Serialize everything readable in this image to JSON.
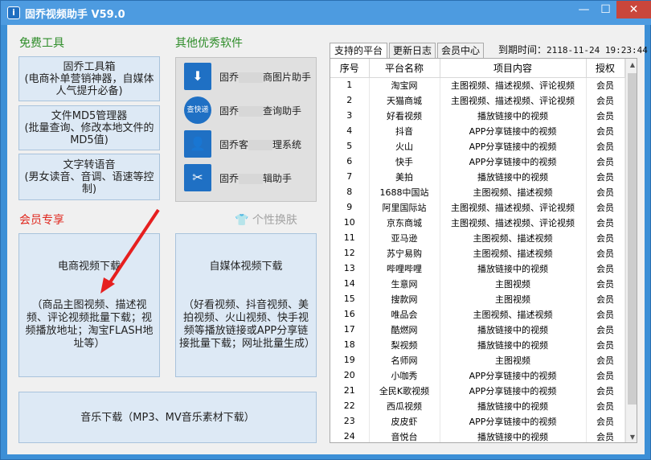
{
  "window": {
    "title": "固乔视频助手 V59.0",
    "icon_letter": "i",
    "minimize": "—",
    "maximize": "☐",
    "close": "✕"
  },
  "free_tools": {
    "heading": "免费工具",
    "buttons": [
      {
        "label": "固乔工具箱\n(电商补单营销神器，自媒体人气提升必备)"
      },
      {
        "label": "文件MD5管理器\n(批量查询、修改本地文件的MD5值)"
      },
      {
        "label": "文字转语音\n(男女读音、音调、语速等控制)"
      }
    ]
  },
  "other_software": {
    "heading": "其他优秀软件",
    "items": [
      {
        "icon": "download-icon",
        "prefix": "固乔",
        "suffix": "商图片助手"
      },
      {
        "icon": "quick-search-icon",
        "prefix": "固乔",
        "suffix": "查询助手"
      },
      {
        "icon": "person-icon",
        "prefix": "固乔客",
        "suffix": "理系统"
      },
      {
        "icon": "scissors-icon",
        "prefix": "固乔",
        "suffix": "辑助手"
      }
    ],
    "skin_label": "个性换肤"
  },
  "member": {
    "heading": "会员专享",
    "ecom_button": "电商视频下载\n\n\n（商品主图视频、描述视频、评论视频批量下载；视频播放地址；淘宝FLASH地址等）",
    "media_button": "自媒体视频下载\n\n\n（好看视频、抖音视频、美拍视频、火山视频、快手视频等播放链接或APP分享链接批量下载；网址批量生成）",
    "music_button": "音乐下载（MP3、MV音乐素材下载）"
  },
  "tabs": [
    "支持的平台",
    "更新日志",
    "会员中心"
  ],
  "expire": {
    "label": "到期时间：",
    "value": "2118-11-24 19:23:44"
  },
  "table": {
    "columns": [
      "序号",
      "平台名称",
      "项目内容",
      "授权"
    ],
    "rows": [
      [
        "1",
        "淘宝网",
        "主图视频、描述视频、评论视频",
        "会员"
      ],
      [
        "2",
        "天猫商城",
        "主图视频、描述视频、评论视频",
        "会员"
      ],
      [
        "3",
        "好看视频",
        "播放链接中的视频",
        "会员"
      ],
      [
        "4",
        "抖音",
        "APP分享链接中的视频",
        "会员"
      ],
      [
        "5",
        "火山",
        "APP分享链接中的视频",
        "会员"
      ],
      [
        "6",
        "快手",
        "APP分享链接中的视频",
        "会员"
      ],
      [
        "7",
        "美拍",
        "播放链接中的视频",
        "会员"
      ],
      [
        "8",
        "1688中国站",
        "主图视频、描述视频",
        "会员"
      ],
      [
        "9",
        "阿里国际站",
        "主图视频、描述视频、评论视频",
        "会员"
      ],
      [
        "10",
        "京东商城",
        "主图视频、描述视频、评论视频",
        "会员"
      ],
      [
        "11",
        "亚马逊",
        "主图视频、描述视频",
        "会员"
      ],
      [
        "12",
        "苏宁易购",
        "主图视频、描述视频",
        "会员"
      ],
      [
        "13",
        "哔哩哔哩",
        "播放链接中的视频",
        "会员"
      ],
      [
        "14",
        "生意网",
        "主图视频",
        "会员"
      ],
      [
        "15",
        "搜款网",
        "主图视频",
        "会员"
      ],
      [
        "16",
        "唯品会",
        "主图视频、描述视频",
        "会员"
      ],
      [
        "17",
        "酷燃网",
        "播放链接中的视频",
        "会员"
      ],
      [
        "18",
        "梨视频",
        "播放链接中的视频",
        "会员"
      ],
      [
        "19",
        "名师网",
        "主图视频",
        "会员"
      ],
      [
        "20",
        "小咖秀",
        "APP分享链接中的视频",
        "会员"
      ],
      [
        "21",
        "全民K歌视频",
        "APP分享链接中的视频",
        "会员"
      ],
      [
        "22",
        "西瓜视频",
        "播放链接中的视频",
        "会员"
      ],
      [
        "23",
        "皮皮虾",
        "APP分享链接中的视频",
        "会员"
      ],
      [
        "24",
        "音悦台",
        "播放链接中的视频",
        "会员"
      ]
    ]
  },
  "colors": {
    "accent_green": "#2f8d2a",
    "accent_red": "#e0261c",
    "title_blue": "#4d9be0"
  }
}
